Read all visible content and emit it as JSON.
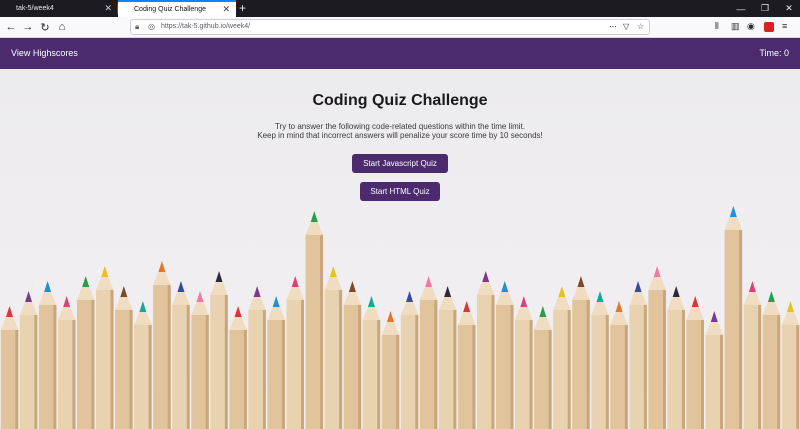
{
  "browser": {
    "tabs": [
      {
        "title": "tak-5/week4",
        "active": false
      },
      {
        "title": "Coding Quiz Challenge",
        "active": true
      }
    ],
    "url": "https://tak-5.github.io/week4/"
  },
  "header": {
    "highscores_label": "View Highscores",
    "timer_label": "Time: 0"
  },
  "main": {
    "title": "Coding Quiz Challenge",
    "intro_line1": "Try to answer the following code-related questions within the time limit.",
    "intro_line2": "Keep in mind that incorrect answers will penalize your score time by 10 seconds!",
    "buttons": {
      "javascript": "Start Javascript Quiz",
      "html": "Start HTML Quiz"
    }
  },
  "colors": {
    "header_bg": "#4b2a6d",
    "button_bg": "#4b2a6d"
  },
  "background": {
    "pencil_colors": [
      "#d9353a",
      "#7b3a8f",
      "#1f8fd6",
      "#e0407a",
      "#2a9c4a",
      "#e8c21a",
      "#7a4a2a",
      "#15a89a",
      "#e8742a",
      "#3a4a9a",
      "#f07aa0",
      "#2a2a3a"
    ]
  }
}
